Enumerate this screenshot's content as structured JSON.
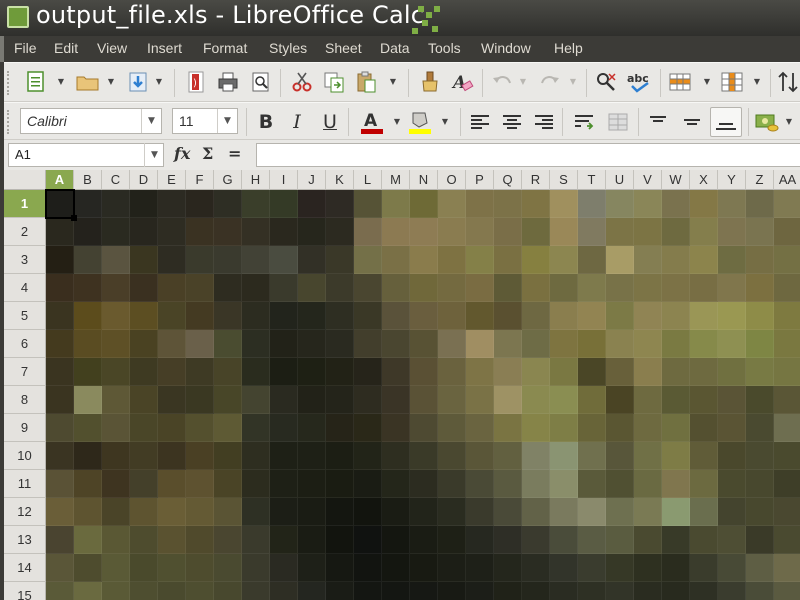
{
  "window": {
    "title": "output_file.xls - LibreOffice Calc"
  },
  "menu": [
    "File",
    "Edit",
    "View",
    "Insert",
    "Format",
    "Styles",
    "Sheet",
    "Data",
    "Tools",
    "Window",
    "Help"
  ],
  "toolbar1": {
    "buttons": [
      "new-document",
      "open",
      "save",
      "export-pdf",
      "print",
      "print-preview",
      "cut",
      "copy",
      "paste",
      "clone-formatting",
      "clear-formatting",
      "undo",
      "redo",
      "find-replace",
      "spelling",
      "row",
      "column",
      "sort"
    ]
  },
  "toolbar2": {
    "font_name": "Calibri",
    "font_size": "11",
    "bold": "B",
    "italic": "I",
    "underline": "U",
    "font_color": "#c00000",
    "highlight_color": "#ffff00"
  },
  "formula_bar": {
    "name_box": "A1",
    "fx_label": "fx",
    "sum_label": "Σ",
    "equals_label": "=",
    "formula_value": ""
  },
  "sheet": {
    "columns": [
      "A",
      "B",
      "C",
      "D",
      "E",
      "F",
      "G",
      "H",
      "I",
      "J",
      "K",
      "L",
      "M",
      "N",
      "O",
      "P",
      "Q",
      "R",
      "S",
      "T",
      "U",
      "V",
      "W",
      "X",
      "Y",
      "Z",
      "AA"
    ],
    "rows": [
      "1",
      "2",
      "3",
      "4",
      "5",
      "6",
      "7",
      "8",
      "9",
      "10",
      "11",
      "12",
      "13",
      "14",
      "15"
    ],
    "active_column": "A",
    "active_row": "1",
    "cell_colors": [
      [
        "#1e1e1a",
        "#262622",
        "#2a2a22",
        "#22221a",
        "#2c2a22",
        "#2a261e",
        "#2e2e24",
        "#3a3e2a",
        "#343a26",
        "#2a2420",
        "#2e2a24",
        "#565336",
        "#7d7a4a",
        "#6e6a36",
        "#8a8052",
        "#7e7248",
        "#7c7248",
        "#7f7444",
        "#a0905e",
        "#7e7e6c",
        "#868660",
        "#8a8658",
        "#7a724e",
        "#847846",
        "#7e7852",
        "#6e6a4a",
        "#807a52"
      ],
      [
        "#2a281e",
        "#24221c",
        "#2a2a20",
        "#28261e",
        "#2e2c22",
        "#3a3222",
        "#3a3224",
        "#343024",
        "#2a281e",
        "#26261c",
        "#2c2a20",
        "#7a6c4e",
        "#8c7a52",
        "#8e7c54",
        "#8a7c50",
        "#84784e",
        "#7a6e48",
        "#6e6a3e",
        "#9a8858",
        "#807a60",
        "#7c7446",
        "#7c7444",
        "#6e6a40",
        "#847e4c",
        "#7e7450",
        "#7a7450",
        "#6e6640"
      ],
      [
        "#241f14",
        "#444232",
        "#5a5440",
        "#3a3620",
        "#2e2c22",
        "#3a3a2c",
        "#3a3a2e",
        "#424236",
        "#4a4c40",
        "#323026",
        "#3a3828",
        "#747048",
        "#7a7046",
        "#8a7c4c",
        "#7e7242",
        "#848048",
        "#7a7042",
        "#868040",
        "#8c8650",
        "#6e6842",
        "#a89c66",
        "#847e52",
        "#847c4c",
        "#8c844c",
        "#6e6c42",
        "#766e44",
        "#747044"
      ],
      [
        "#3a2e1e",
        "#3e3220",
        "#4a3e28",
        "#3a3020",
        "#4a4026",
        "#4a4228",
        "#2e2c20",
        "#2c2a1e",
        "#3a3a2c",
        "#48462e",
        "#3c3a2a",
        "#4a4630",
        "#66603c",
        "#70683a",
        "#746a40",
        "#7a6c42",
        "#5e5a36",
        "#7a7040",
        "#6e6a40",
        "#7e7a4c",
        "#787248",
        "#7c7446",
        "#7c7246",
        "#786e44",
        "#80764c",
        "#7c7040",
        "#6e6840"
      ],
      [
        "#3a3420",
        "#5c4c1c",
        "#6a5a2e",
        "#5c4e22",
        "#4a4426",
        "#443a22",
        "#3a3626",
        "#2c2c20",
        "#22241c",
        "#24261c",
        "#2e2e22",
        "#3a3826",
        "#5a523a",
        "#6a5e3e",
        "#6e623c",
        "#62582e",
        "#5a5030",
        "#6e6842",
        "#8a7e4e",
        "#928452",
        "#7c7a46",
        "#908454",
        "#8c8450",
        "#9a9656",
        "#9a9852",
        "#8e8c48",
        "#7e7a40"
      ],
      [
        "#443a1e",
        "#5a4c22",
        "#5e5026",
        "#4a4222",
        "#5e5438",
        "#6a604a",
        "#4a4c30",
        "#2c2e22",
        "#222218",
        "#26261c",
        "#2a2a20",
        "#423e2c",
        "#4a4630",
        "#585234",
        "#7a7052",
        "#a08e62",
        "#7c7650",
        "#6e6c46",
        "#7e7440",
        "#787038",
        "#8a8250",
        "#8e8650",
        "#7a7a42",
        "#868a4a",
        "#8e9052",
        "#7e8644",
        "#7a7840"
      ],
      [
        "#3a3420",
        "#42401e",
        "#4a4626",
        "#3e3a22",
        "#463e26",
        "#3e3a24",
        "#484428",
        "#2a2c1e",
        "#1c1e14",
        "#1e2014",
        "#222216",
        "#26241a",
        "#3e3828",
        "#5a5034",
        "#6a623e",
        "#7e7446",
        "#8a7e54",
        "#8a8650",
        "#7a7842",
        "#4a4626",
        "#68603a",
        "#8a7e4e",
        "#6e6a40",
        "#6e6a40",
        "#707040",
        "#787a44",
        "#767642"
      ],
      [
        "#3a3420",
        "#8a8a5e",
        "#5e5836",
        "#4a4426",
        "#3a3622",
        "#3a3822",
        "#484628",
        "#444430",
        "#2a2a20",
        "#222218",
        "#24241a",
        "#2e2c20",
        "#3a3426",
        "#5a5236",
        "#6a6440",
        "#7a7246",
        "#9e9264",
        "#8a8a50",
        "#8a8e52",
        "#706c3a",
        "#4a4424",
        "#6e6a40",
        "#5a5a34",
        "#5a5632",
        "#5a5436",
        "#4a4a2c",
        "#5a5636"
      ],
      [
        "#4e4a30",
        "#52502e",
        "#5a5436",
        "#4a4628",
        "#4a4426",
        "#54502e",
        "#5e5a34",
        "#323426",
        "#282a20",
        "#26281c",
        "#262418",
        "#2a2818",
        "#3a3424",
        "#4e4a32",
        "#5e5a3a",
        "#6a6440",
        "#7a7442",
        "#868448",
        "#7e7e46",
        "#686438",
        "#5a5632",
        "#6e6a40",
        "#707040",
        "#545030",
        "#5a5434",
        "#4a4a30",
        "#6e6e50"
      ],
      [
        "#3a3422",
        "#2e281a",
        "#3e3620",
        "#423c24",
        "#3c3420",
        "#4a4024",
        "#423e22",
        "#2e2e20",
        "#1e2016",
        "#1e2016",
        "#1c1e14",
        "#222418",
        "#2e2e20",
        "#3a3a28",
        "#4a4830",
        "#5a5638",
        "#626040",
        "#808266",
        "#8a9472",
        "#70704e",
        "#58563a",
        "#707046",
        "#7e7c46",
        "#605c38",
        "#4a482c",
        "#4a4a30",
        "#4a4a2e"
      ],
      [
        "#5a5236",
        "#4e4426",
        "#3e3420",
        "#44402a",
        "#5a4e2c",
        "#5e5230",
        "#4a4426",
        "#2c2c1e",
        "#1e2016",
        "#1c1e14",
        "#1a1c12",
        "#1a1c14",
        "#24261a",
        "#2c2c20",
        "#3a3a2a",
        "#4a4a36",
        "#5a5a40",
        "#7a7c5e",
        "#8a8e6a",
        "#5a5a3a",
        "#505032",
        "#6a6a42",
        "#80764e",
        "#6c6a40",
        "#4a4a2e",
        "#48482e",
        "#3e3e28"
      ],
      [
        "#6a5e38",
        "#5e5430",
        "#4a4428",
        "#5e5430",
        "#6a5e36",
        "#645a34",
        "#5a5434",
        "#2e3024",
        "#1c1e16",
        "#1a1c14",
        "#141610",
        "#12140e",
        "#1a1c14",
        "#22241a",
        "#2a2c20",
        "#3a3a2c",
        "#4a4a38",
        "#626248",
        "#7a7a5e",
        "#8a8a6c",
        "#6e7050",
        "#7a7a54",
        "#8a9a70",
        "#6a6e4e",
        "#44442e",
        "#48482e",
        "#4a4830"
      ],
      [
        "#4a4430",
        "#6a6a3e",
        "#5a5834",
        "#4e4c2e",
        "#5a5230",
        "#504a2c",
        "#4a4630",
        "#3a3a2c",
        "#222418",
        "#1a1c14",
        "#12140e",
        "#101210",
        "#141610",
        "#1a1c14",
        "#1e2016",
        "#262820",
        "#2e2e26",
        "#3a3a2e",
        "#4a4c3a",
        "#5a5c44",
        "#5a5c40",
        "#4a4a30",
        "#383a28",
        "#4a4a30",
        "#4e4e34",
        "#3a3a28",
        "#4a4a30"
      ],
      [
        "#5a5638",
        "#4e4c2e",
        "#5a5a36",
        "#4a4a2c",
        "#505030",
        "#4e4c2e",
        "#4a4a30",
        "#3a3a2c",
        "#2a2a22",
        "#1e2018",
        "#161812",
        "#121410",
        "#141610",
        "#181a12",
        "#1c1e16",
        "#1e2018",
        "#24261c",
        "#2a2c22",
        "#32342a",
        "#3a3c2e",
        "#363826",
        "#2e3020",
        "#2a2c1e",
        "#3a3c2c",
        "#484a36",
        "#5e5e44",
        "#6e6a4a"
      ],
      [
        "#5a5a38",
        "#6a6a40",
        "#5a5a36",
        "#4e4e30",
        "#4a4a2e",
        "#4e4e30",
        "#48482e",
        "#3a3a2c",
        "#2e2e24",
        "#242620",
        "#1a1c16",
        "#141612",
        "#141612",
        "#161814",
        "#181a14",
        "#1c1e18",
        "#202218",
        "#24261c",
        "#2a2c22",
        "#2e3024",
        "#323428",
        "#2a2c20",
        "#282a1e",
        "#2e3024",
        "#3a3c2e",
        "#4a4c38",
        "#5a5a40"
      ]
    ]
  }
}
